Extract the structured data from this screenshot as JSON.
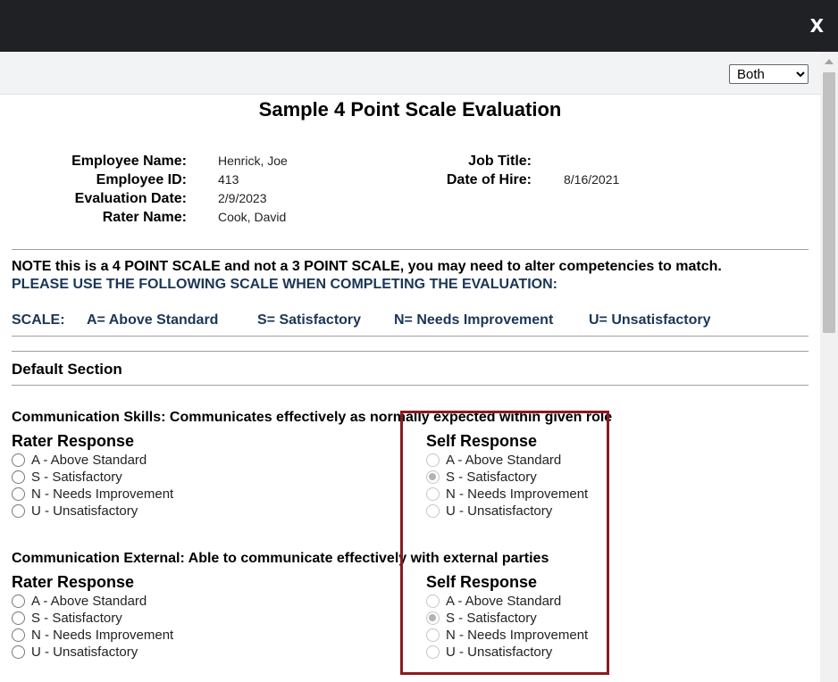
{
  "window": {
    "close_label": "X"
  },
  "toolbar": {
    "view_select": {
      "selected": "Both",
      "options": [
        "Both"
      ]
    }
  },
  "evaluation": {
    "title": "Sample 4 Point Scale Evaluation",
    "employee": {
      "name_label": "Employee Name:",
      "name": "Henrick, Joe",
      "id_label": "Employee ID:",
      "id": "413",
      "eval_date_label": "Evaluation Date:",
      "eval_date": "2/9/2023",
      "rater_label": "Rater Name:",
      "rater": "Cook, David",
      "job_title_label": "Job Title:",
      "job_title": "",
      "hire_date_label": "Date of Hire:",
      "hire_date": "8/16/2021"
    },
    "note": "NOTE this is a 4 POINT SCALE and not a 3 POINT SCALE, you may need to alter competencies to match.",
    "scale_instruction": "PLEASE USE THE FOLLOWING SCALE WHEN COMPLETING THE EVALUATION:",
    "scale": {
      "label": "SCALE:",
      "items": [
        "A= Above Standard",
        "S= Satisfactory",
        "N= Needs Improvement",
        "U= Unsatisfactory"
      ]
    },
    "section_title": "Default Section",
    "rater_response_title": "Rater Response",
    "self_response_title": "Self Response",
    "options": [
      "A - Above Standard",
      "S - Satisfactory",
      "N - Needs Improvement",
      "U - Unsatisfactory"
    ],
    "competencies": [
      {
        "title": "Communication Skills:   Communicates effectively as normally   expected   within  given role",
        "self_selected": "S - Satisfactory"
      },
      {
        "title": "Communication External: Able to communicate effectively with external parties",
        "self_selected": "S - Satisfactory"
      }
    ]
  }
}
